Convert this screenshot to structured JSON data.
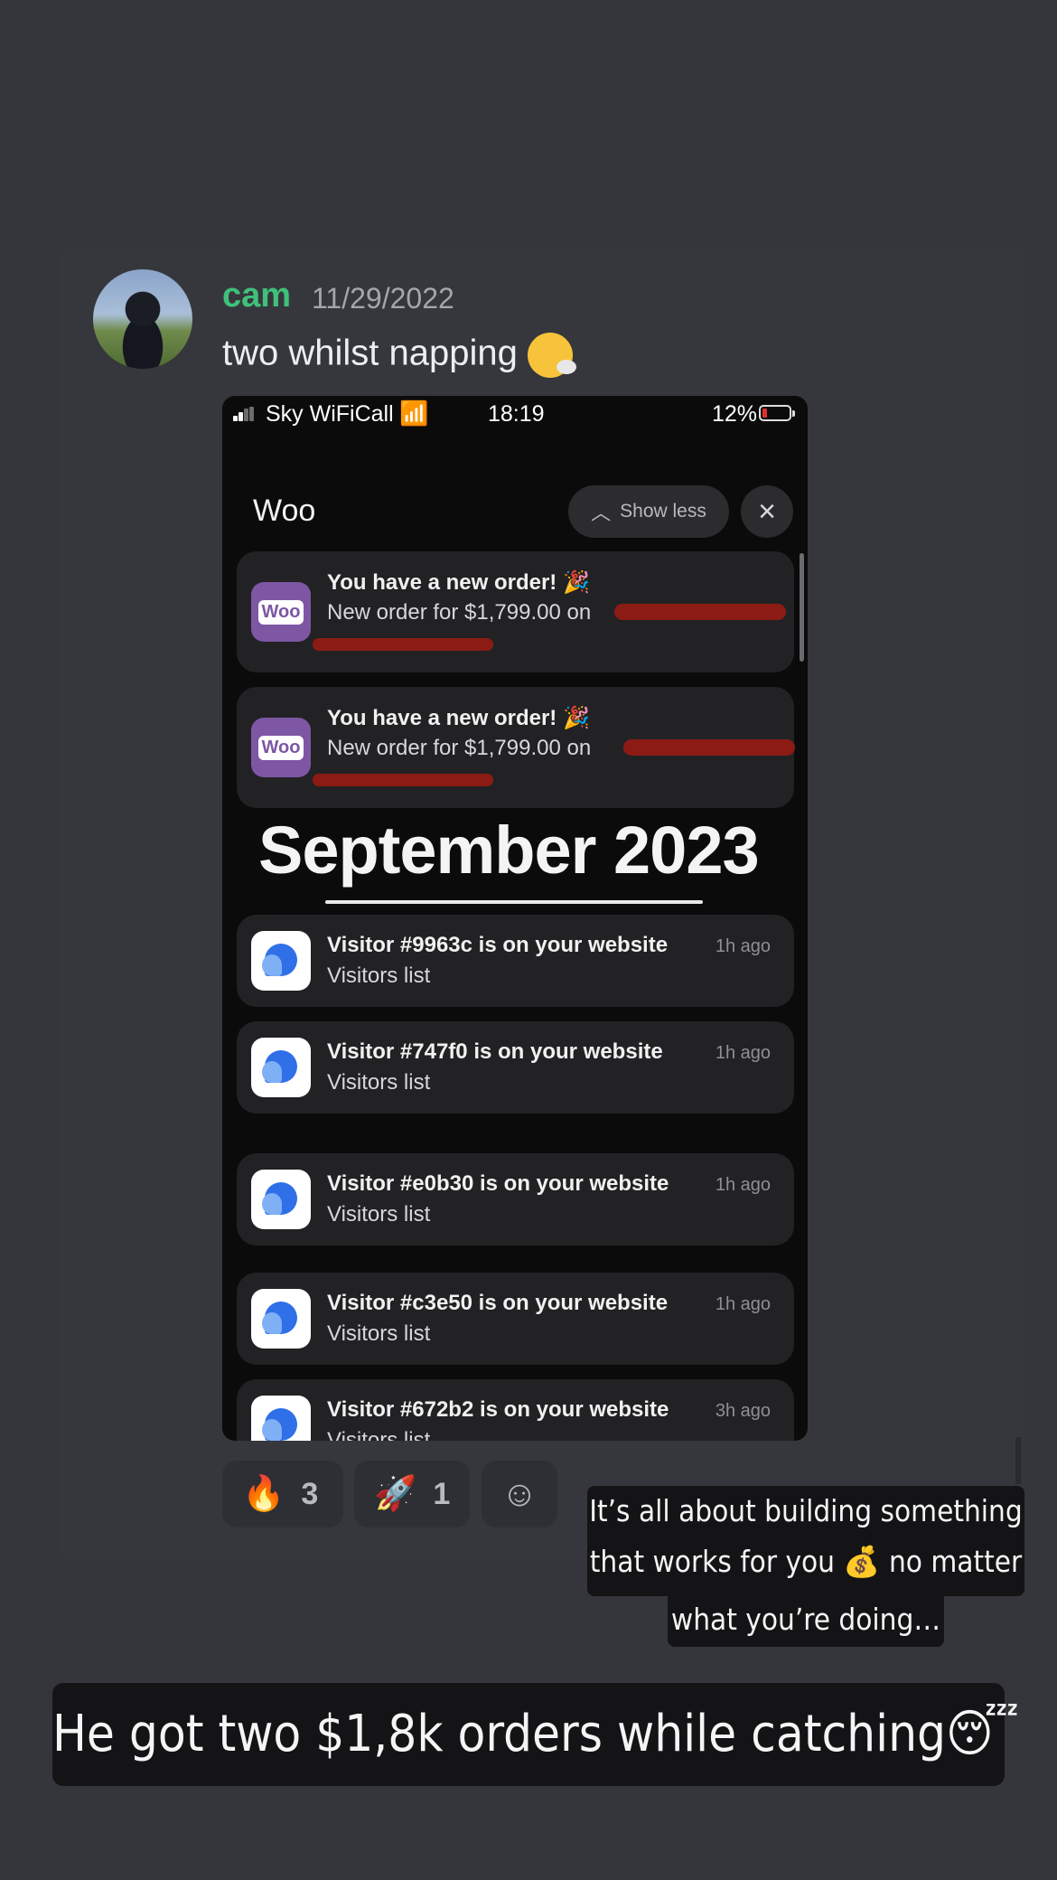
{
  "message": {
    "username": "cam",
    "timestamp": "11/29/2022",
    "text": "two whilst napping",
    "emoji": "weary-face-icon"
  },
  "phone": {
    "carrier": "Sky WiFiCall",
    "time": "18:19",
    "battery": "12%",
    "group_title": "Woo",
    "show_less": "Show less",
    "orders": [
      {
        "title": "You have a new order!",
        "body": "New order for $1,799.00 on"
      },
      {
        "title": "You have a new order!",
        "body": "New order for $1,799.00 on"
      }
    ],
    "overlay_heading": "September 2023",
    "visitors": [
      {
        "title": "Visitor #9963c is on your website",
        "sub": "Visitors list",
        "ago": "1h ago"
      },
      {
        "title": "Visitor #747f0 is on your website",
        "sub": "Visitors list",
        "ago": "1h ago"
      },
      {
        "title": "Visitor #e0b30 is on your website",
        "sub": "Visitors list",
        "ago": "1h ago"
      },
      {
        "title": "Visitor #c3e50 is on your website",
        "sub": "Visitors list",
        "ago": "1h ago"
      },
      {
        "title": "Visitor #672b2 is on your website",
        "sub": "Visitors list",
        "ago": "3h ago"
      }
    ]
  },
  "reactions": [
    {
      "emoji": "🔥",
      "count": "3"
    },
    {
      "emoji": "🚀",
      "count": "1"
    }
  ],
  "captions": {
    "small_line1": "It’s all about building something",
    "small_line2": "that works for you 💰 no matter",
    "small_line3": "what you’re doing…",
    "big": "He got two $1,8k orders while catching😴"
  },
  "colors": {
    "background": "#35363b",
    "username": "#3fc17a",
    "woo_purple": "#7d57a4",
    "redaction": "#8c1b15"
  }
}
